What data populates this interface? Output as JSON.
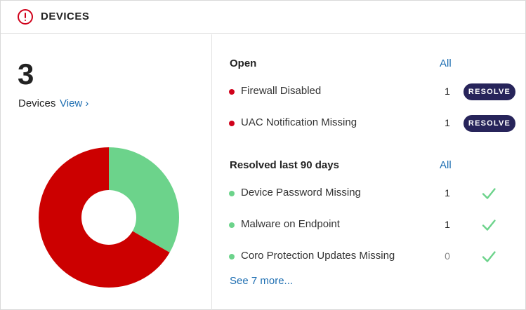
{
  "header": {
    "title": "DEVICES",
    "icon": "alert-circle-icon"
  },
  "summary": {
    "count": "3",
    "label": "Devices",
    "view_link": "View ›"
  },
  "chart_data": {
    "type": "pie",
    "donut": true,
    "categories": [
      "Resolved",
      "Open"
    ],
    "values": [
      1,
      2
    ],
    "colors": [
      "#6cd38b",
      "#cc0000"
    ]
  },
  "open": {
    "title": "Open",
    "all_link": "All",
    "items": [
      {
        "label": "Firewall Disabled",
        "count": "1",
        "action": "RESOLVE"
      },
      {
        "label": "UAC Notification Missing",
        "count": "1",
        "action": "RESOLVE"
      }
    ]
  },
  "resolved": {
    "title": "Resolved last 90 days",
    "all_link": "All",
    "items": [
      {
        "label": "Device Password Missing",
        "count": "1"
      },
      {
        "label": "Malware on Endpoint",
        "count": "1"
      },
      {
        "label": "Coro Protection Updates Missing",
        "count": "0"
      }
    ]
  },
  "see_more": "See 7 more...",
  "colors": {
    "accent": "#1f6fb2",
    "alert": "#d0021b",
    "success": "#6cd38b",
    "button": "#27245a"
  }
}
